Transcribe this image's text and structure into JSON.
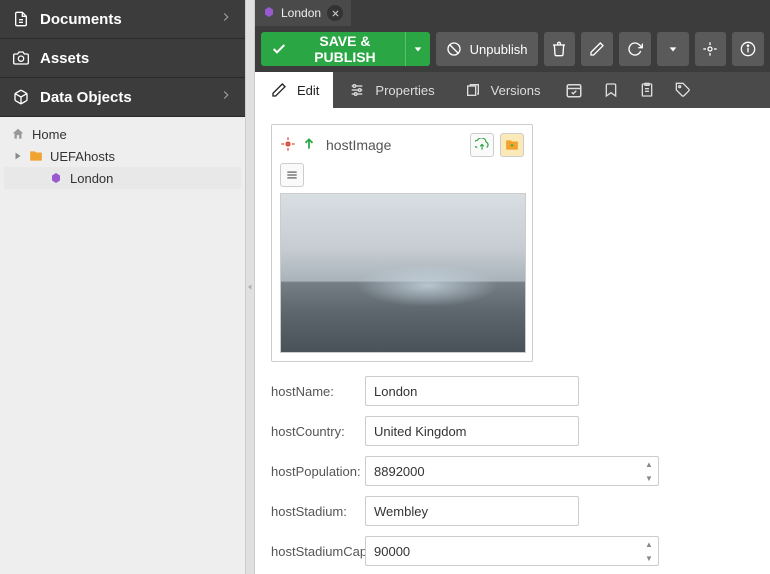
{
  "sidebar": {
    "sections": [
      {
        "label": "Documents"
      },
      {
        "label": "Assets"
      },
      {
        "label": "Data Objects"
      }
    ],
    "tree": {
      "root": "Home",
      "folder": "UEFAhosts",
      "item": "London"
    }
  },
  "tab": {
    "title": "London"
  },
  "toolbar": {
    "save_publish": "SAVE & PUBLISH",
    "unpublish": "Unpublish"
  },
  "subtabs": {
    "edit": "Edit",
    "properties": "Properties",
    "versions": "Versions"
  },
  "imagePanel": {
    "label": "hostImage"
  },
  "fields": {
    "hostName": {
      "label": "hostName:",
      "value": "London"
    },
    "hostCountry": {
      "label": "hostCountry:",
      "value": "United Kingdom"
    },
    "hostPopulation": {
      "label": "hostPopulation:",
      "value": "8892000"
    },
    "hostStadium": {
      "label": "hostStadium:",
      "value": "Wembley"
    },
    "hostStadiumCap": {
      "label": "hostStadiumCap:",
      "value": "90000"
    }
  }
}
